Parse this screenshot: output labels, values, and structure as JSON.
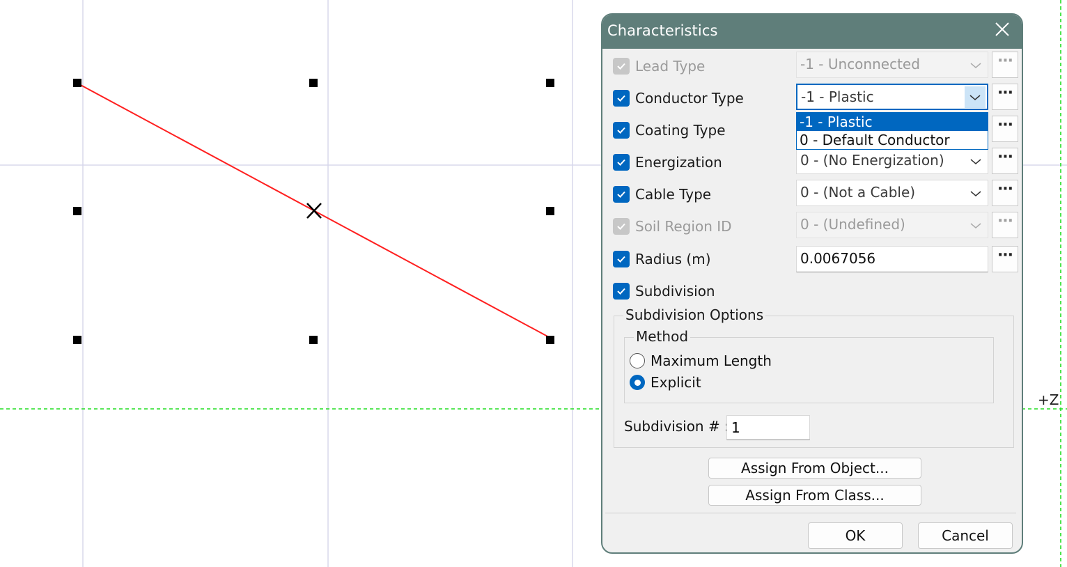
{
  "canvas": {
    "axis_label": "+Z"
  },
  "dialog": {
    "title": "Characteristics",
    "close_icon": "close-icon",
    "fields": [
      {
        "label": "Lead Type",
        "checked": true,
        "enabled": false,
        "value": "-1 - Unconnected"
      },
      {
        "label": "Conductor Type",
        "checked": true,
        "enabled": true,
        "value": "-1 - Plastic"
      },
      {
        "label": "Coating Type",
        "checked": true,
        "enabled": true,
        "value": ""
      },
      {
        "label": "Energization",
        "checked": true,
        "enabled": true,
        "value": "0 - (No Energization)"
      },
      {
        "label": "Cable Type",
        "checked": true,
        "enabled": true,
        "value": "0 - (Not a Cable)"
      },
      {
        "label": "Soil Region ID",
        "checked": true,
        "enabled": false,
        "value": "0 - (Undefined)"
      },
      {
        "label": "Radius (m)",
        "checked": true,
        "enabled": true,
        "value": "0.0067056"
      },
      {
        "label": "Subdivision",
        "checked": true,
        "enabled": true
      }
    ],
    "ellipsis": "···",
    "dropdown_options": [
      "-1 - Plastic",
      "0 - Default Conductor"
    ],
    "subdivision_options": {
      "title": "Subdivision Options",
      "method_title": "Method",
      "methods": [
        "Maximum Length",
        "Explicit"
      ],
      "selected_method": "Explicit",
      "count_label": "Subdivision # :",
      "count_value": "1"
    },
    "buttons": {
      "assign_object": "Assign From Object...",
      "assign_class": "Assign From Class...",
      "ok": "OK",
      "cancel": "Cancel"
    }
  },
  "colors": {
    "accent": "#0067c0",
    "titlebar": "#5f7e7a",
    "line": "#ff2020",
    "guide": "#22dd22"
  }
}
